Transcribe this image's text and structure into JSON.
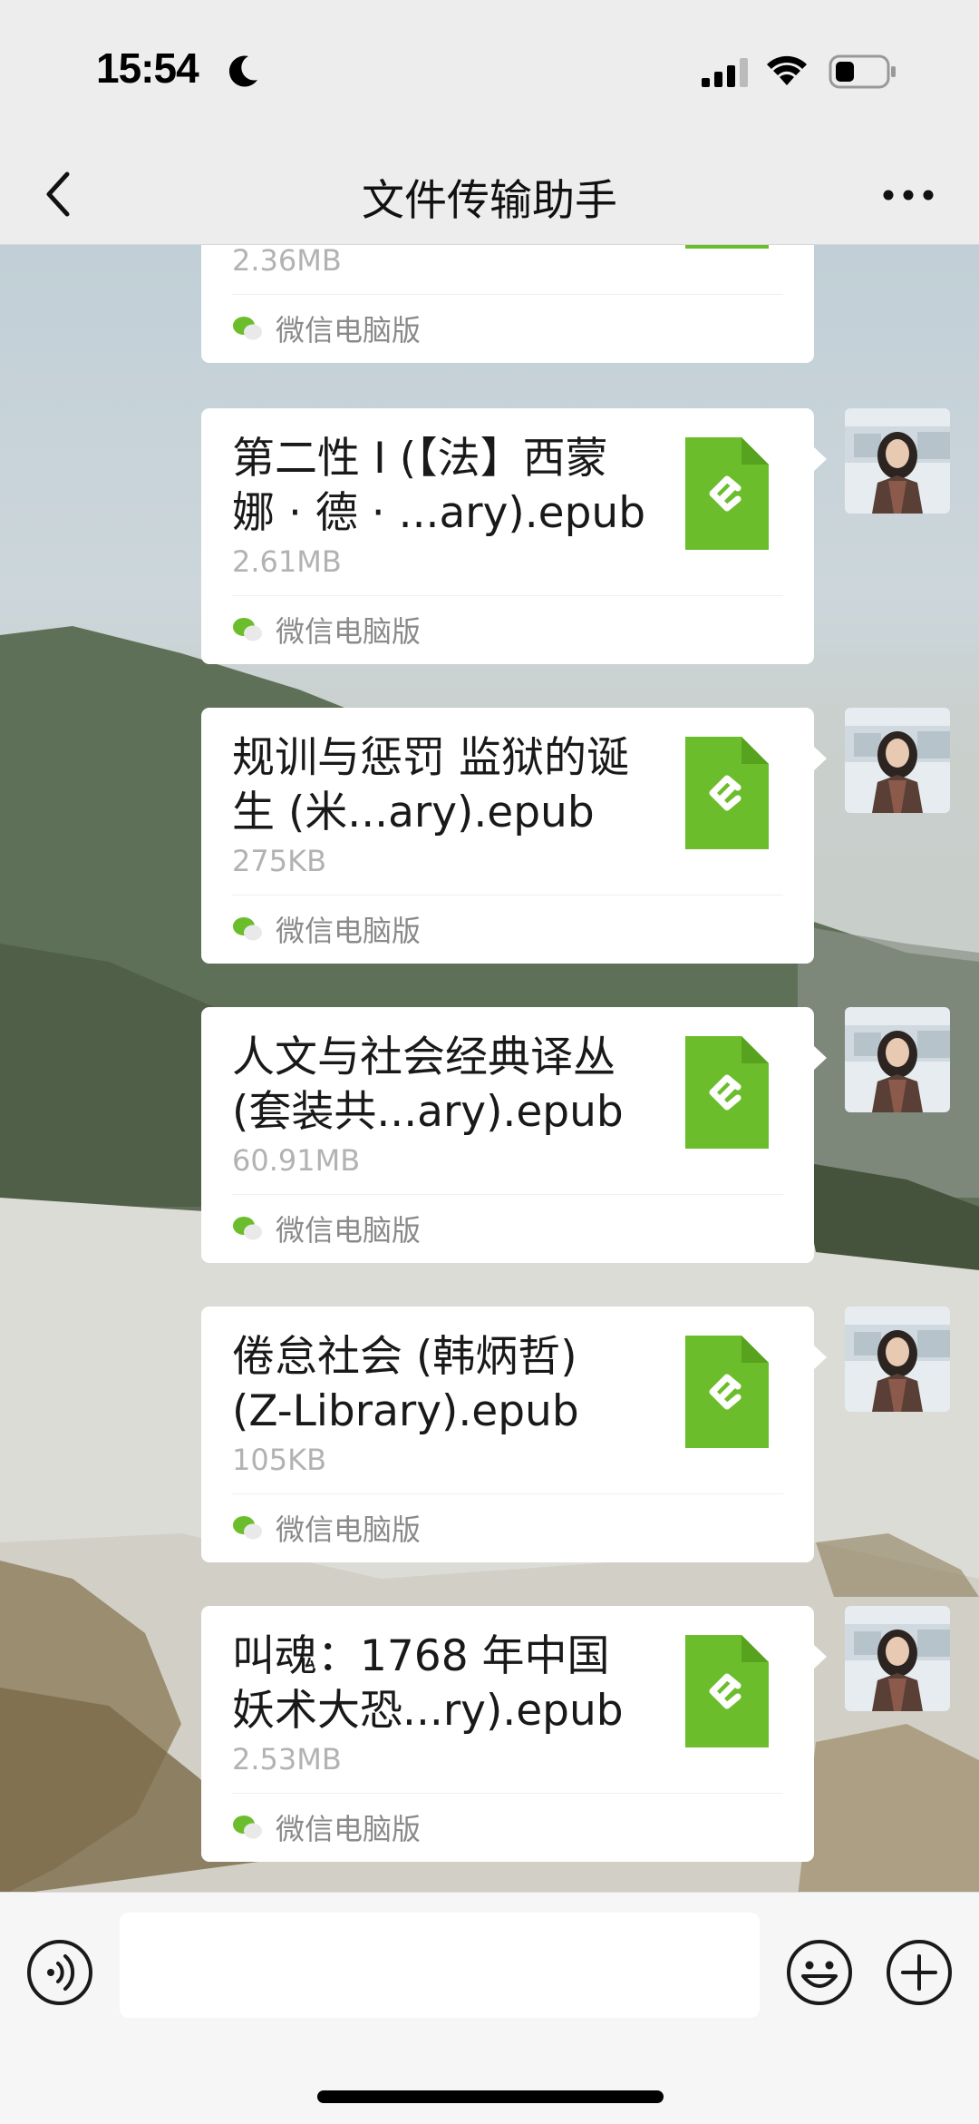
{
  "status_bar": {
    "time": "15:54"
  },
  "nav": {
    "title": "文件传输助手",
    "back_icon": "chevron-left-icon",
    "more_icon": "more-dots-icon"
  },
  "messages": [
    {
      "name": "",
      "size": "2.36MB",
      "source": "微信电脑版"
    },
    {
      "name": "第二性 I (【法】西蒙娜 · 德 · ...ary).epub",
      "size": "2.61MB",
      "source": "微信电脑版"
    },
    {
      "name": "规训与惩罚 监狱的诞生 (米...ary).epub",
      "size": "275KB",
      "source": "微信电脑版"
    },
    {
      "name": "人文与社会经典译丛 (套装共...ary).epub",
      "size": "60.91MB",
      "source": "微信电脑版"
    },
    {
      "name": "倦怠社会 (韩炳哲) (Z-Library).epub",
      "size": "105KB",
      "source": "微信电脑版"
    },
    {
      "name": "叫魂：1768 年中国妖术大恐...ry).epub",
      "size": "2.53MB",
      "source": "微信电脑版"
    }
  ],
  "file_icon": "epub-file-icon",
  "file_icon_color": "#6cbd2c",
  "input_bar": {
    "input_value": "",
    "voice_icon": "voice-icon",
    "emoji_icon": "emoji-icon",
    "plus_icon": "plus-icon"
  }
}
